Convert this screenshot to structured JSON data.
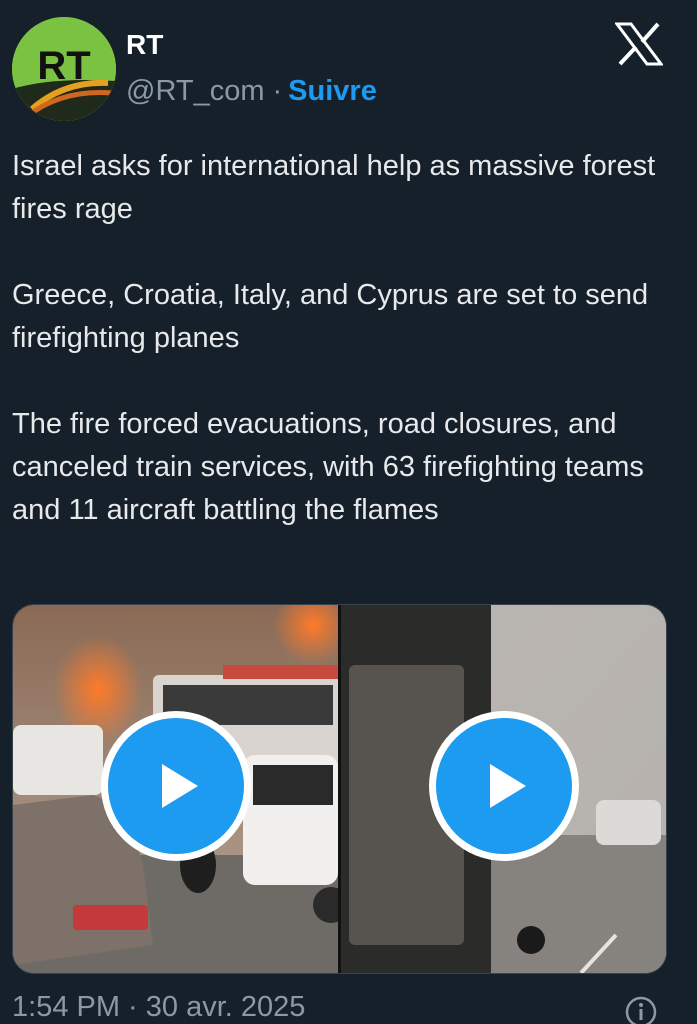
{
  "account": {
    "name": "RT",
    "handle": "@RT_com",
    "separator": "·",
    "follow_label": "Suivre",
    "avatar_text": "RT",
    "avatar_icon": "rt-logo-avatar"
  },
  "header": {
    "close_icon": "x-logo-icon"
  },
  "tweet": {
    "paragraphs": [
      "Israel asks for international help as massive forest fires rage",
      "Greece, Croatia, Italy, and Cyprus are set to send firefighting planes",
      "The fire forced evacuations, road closures, and canceled train services, with 63 firefighting teams and 11 aircraft battling the flames"
    ]
  },
  "media": {
    "videos": [
      {
        "icon": "play-icon"
      },
      {
        "icon": "play-icon"
      }
    ]
  },
  "footer": {
    "timestamp": "1:54 PM · 30 avr. 2025",
    "info_icon": "info-icon"
  },
  "colors": {
    "background": "#15202b",
    "text": "#e7e9ea",
    "secondary": "#8b98a5",
    "accent": "#1d9bf0",
    "avatar_green": "#7cc242"
  }
}
